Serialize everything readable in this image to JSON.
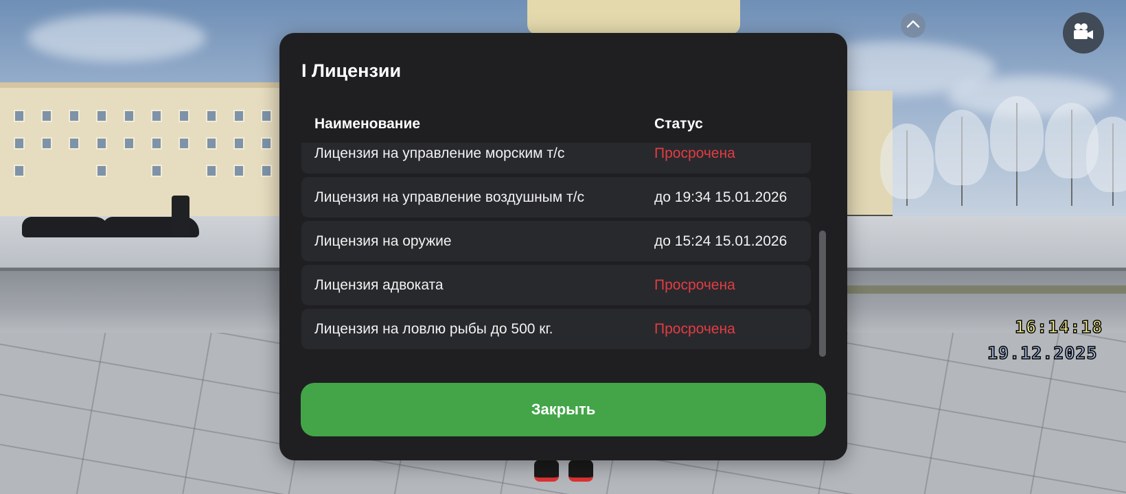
{
  "dialog": {
    "title": "I Лицензии",
    "columns": {
      "name": "Наименование",
      "status": "Статус"
    },
    "licenses": [
      {
        "name": "Лицензия на управление морским т/с",
        "status": "Просрочена",
        "expired": true
      },
      {
        "name": "Лицензия на управление воздушным т/с",
        "status": "до 19:34 15.01.2026",
        "expired": false
      },
      {
        "name": "Лицензия на оружие",
        "status": "до 15:24 15.01.2026",
        "expired": false
      },
      {
        "name": "Лицензия адвоката",
        "status": "Просрочена",
        "expired": true
      },
      {
        "name": "Лицензия на ловлю рыбы до 500 кг.",
        "status": "Просрочена",
        "expired": true
      }
    ],
    "close_label": "Закрыть"
  },
  "hud": {
    "time": "16:14:18",
    "date": "19.12.2025",
    "scroll_up_icon": "chevron-up-icon",
    "camera_icon": "video-camera-icon"
  },
  "colors": {
    "dialog_bg": "#1f1f22",
    "row_bg": "#28292d",
    "expired": "#e23d43",
    "close_button": "#43a548",
    "hud_time": "#f4ee8c",
    "hud_date": "#9fb1d6"
  }
}
